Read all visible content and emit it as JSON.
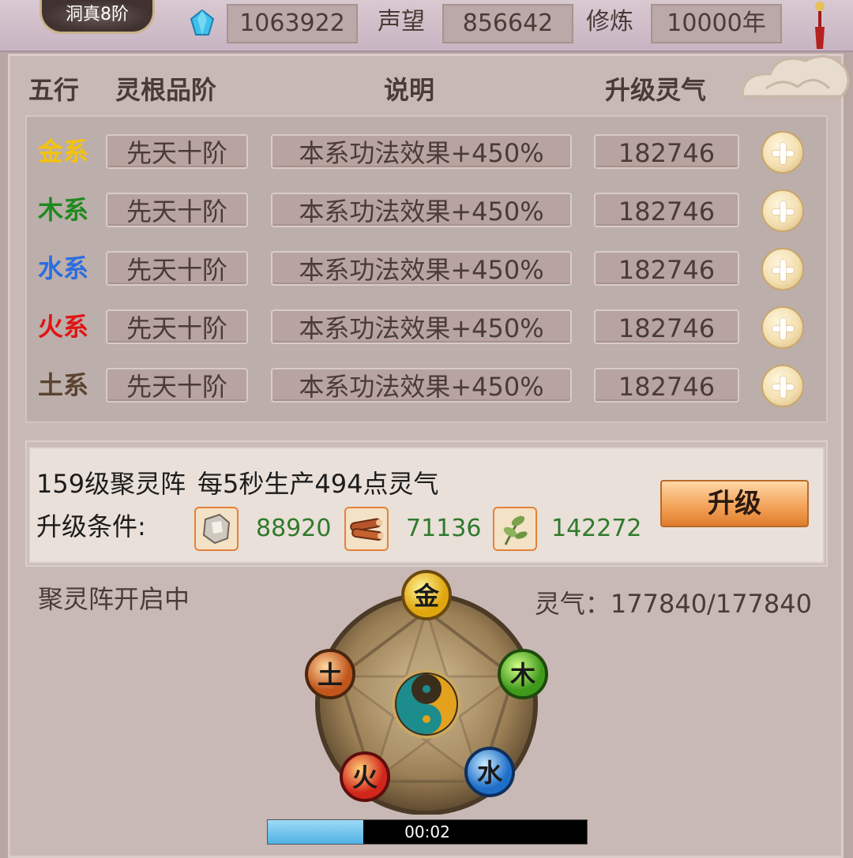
{
  "header": {
    "rank": "洞真8阶",
    "gems": "1063922",
    "prestige_label": "声望",
    "prestige": "856642",
    "cultivation_label": "修炼",
    "cultivation": "10000年"
  },
  "table": {
    "headers": {
      "element": "五行",
      "grade": "灵根品阶",
      "desc": "说明",
      "cost": "升级灵气"
    },
    "rows": [
      {
        "element": "金系",
        "color": "#f4c20d",
        "grade": "先天十阶",
        "desc": "本系功法效果+450%",
        "cost": "182746"
      },
      {
        "element": "木系",
        "color": "#1f8a1f",
        "grade": "先天十阶",
        "desc": "本系功法效果+450%",
        "cost": "182746"
      },
      {
        "element": "水系",
        "color": "#2b6de0",
        "grade": "先天十阶",
        "desc": "本系功法效果+450%",
        "cost": "182746"
      },
      {
        "element": "火系",
        "color": "#e01515",
        "grade": "先天十阶",
        "desc": "本系功法效果+450%",
        "cost": "182746"
      },
      {
        "element": "土系",
        "color": "#5a4330",
        "grade": "先天十阶",
        "desc": "本系功法效果+450%",
        "cost": "182746"
      }
    ]
  },
  "formation": {
    "title": "159级聚灵阵",
    "production": "每5秒生产494点灵气",
    "cond_label": "升级条件:",
    "materials": [
      {
        "icon": "stone-icon",
        "value": "88920"
      },
      {
        "icon": "wood-icon",
        "value": "71136"
      },
      {
        "icon": "herb-icon",
        "value": "142272"
      }
    ],
    "upgrade_label": "升级"
  },
  "status": {
    "text": "聚灵阵开启中",
    "qi": "灵气：177840/177840",
    "timer": "00:02",
    "progress": 0.3
  },
  "wheel": {
    "nodes": [
      "金",
      "木",
      "水",
      "火",
      "土"
    ]
  }
}
